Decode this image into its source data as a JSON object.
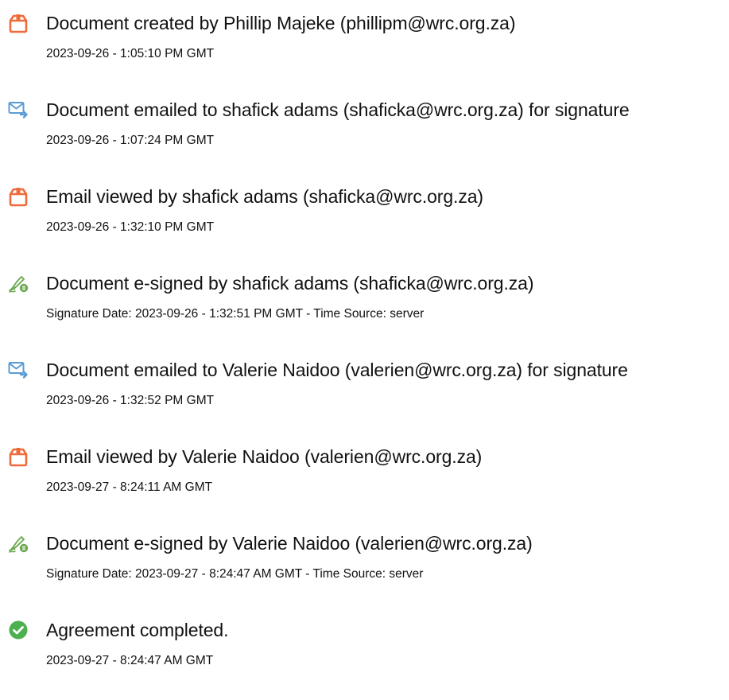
{
  "icons": {
    "document": "document-icon",
    "email": "email-sent-icon",
    "esign": "esign-pen-icon",
    "completed": "check-circle-icon"
  },
  "colors": {
    "document_icon": "#f06b3c",
    "email_icon": "#5b9bd5",
    "esign_icon": "#6aa84f",
    "completed_icon": "#4caf50"
  },
  "events": [
    {
      "icon": "document-icon",
      "title": "Document created by Phillip Majeke (phillipm@wrc.org.za)",
      "time": "2023-09-26 - 1:05:10 PM GMT"
    },
    {
      "icon": "email-sent-icon",
      "title": "Document emailed to shafick adams (shaficka@wrc.org.za) for signature",
      "time": "2023-09-26 - 1:07:24 PM GMT"
    },
    {
      "icon": "document-icon",
      "title": "Email viewed by shafick adams (shaficka@wrc.org.za)",
      "time": "2023-09-26 - 1:32:10 PM GMT"
    },
    {
      "icon": "esign-pen-icon",
      "title": "Document e-signed by shafick adams (shaficka@wrc.org.za)",
      "time": "Signature Date: 2023-09-26 - 1:32:51 PM GMT - Time Source: server"
    },
    {
      "icon": "email-sent-icon",
      "title": "Document emailed to Valerie Naidoo (valerien@wrc.org.za) for signature",
      "time": "2023-09-26 - 1:32:52 PM GMT"
    },
    {
      "icon": "document-icon",
      "title": "Email viewed by Valerie Naidoo (valerien@wrc.org.za)",
      "time": "2023-09-27 - 8:24:11 AM GMT"
    },
    {
      "icon": "esign-pen-icon",
      "title": "Document e-signed by Valerie Naidoo (valerien@wrc.org.za)",
      "time": "Signature Date: 2023-09-27 - 8:24:47 AM GMT - Time Source: server"
    },
    {
      "icon": "check-circle-icon",
      "title": "Agreement completed.",
      "time": "2023-09-27 - 8:24:47 AM GMT"
    }
  ]
}
